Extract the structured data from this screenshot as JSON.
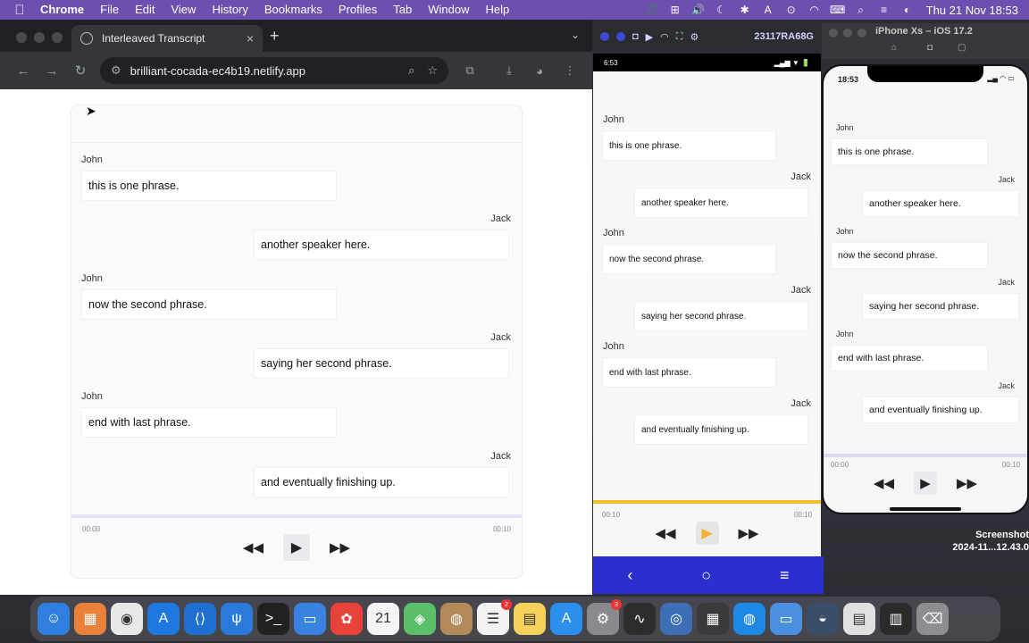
{
  "menubar": {
    "apple": "",
    "app": "Chrome",
    "items": [
      "File",
      "Edit",
      "View",
      "History",
      "Bookmarks",
      "Profiles",
      "Tab",
      "Window",
      "Help"
    ],
    "status_icons": [
      "🎵",
      "⊞",
      "🔊",
      "☾",
      "✱",
      "A",
      "⊙",
      "◠",
      "⌨",
      "⌕",
      "≡",
      "◐"
    ],
    "clock": "Thu 21 Nov  18:53"
  },
  "chrome": {
    "tab_title": "Interleaved Transcript",
    "tab_close": "×",
    "new_tab": "+",
    "tab_menu": "⌄",
    "url": "brilliant-cocada-ec4b19.netlify.app",
    "nav_back": "←",
    "nav_forward": "→",
    "nav_reload": "↻"
  },
  "transcript": {
    "turns": [
      {
        "speaker": "John",
        "text": "this is one phrase."
      },
      {
        "speaker": "Jack",
        "text": "another speaker here."
      },
      {
        "speaker": "John",
        "text": "now the second phrase."
      },
      {
        "speaker": "Jack",
        "text": "saying her second phrase."
      },
      {
        "speaker": "John",
        "text": "end with last phrase."
      },
      {
        "speaker": "Jack",
        "text": "and eventually finishing up."
      }
    ],
    "player": {
      "current_time": "00:00",
      "duration": "00:10",
      "progress": 0,
      "rewind": "◀◀",
      "play": "▶",
      "forward": "▶▶"
    }
  },
  "android": {
    "window_title": "23117RA68G",
    "status_time": "6:53",
    "status_signal": "▂▄▆ ▼ 🔋",
    "current_time": "00:10",
    "duration": "00:10",
    "progress": 1.0,
    "nav_back": "‹",
    "nav_home": "○",
    "nav_menu": "≡"
  },
  "ios": {
    "window_title": "iPhone Xs – iOS 17.2",
    "status_time": "18:53",
    "status_icons": "▂▄ ◠ ▭",
    "current_time": "00:00",
    "duration": "00:10",
    "progress": 0
  },
  "screenshot_label": {
    "line1": "Screenshot",
    "line2": "2024-11...12.43.0"
  },
  "dock": {
    "icons": [
      {
        "name": "finder-icon",
        "color": "#2f7fe0",
        "glyph": "☺"
      },
      {
        "name": "launchpad-icon",
        "color": "#e9813b",
        "glyph": "▦"
      },
      {
        "name": "chrome-icon",
        "color": "#e8e8e8",
        "glyph": "◉"
      },
      {
        "name": "xcode-icon",
        "color": "#1e78e0",
        "glyph": "A"
      },
      {
        "name": "vscode-icon",
        "color": "#1f6fd1",
        "glyph": "⟨⟩"
      },
      {
        "name": "fork-icon",
        "color": "#2a7ad9",
        "glyph": "ψ"
      },
      {
        "name": "terminal-icon",
        "color": "#222222",
        "glyph": ">_"
      },
      {
        "name": "simulator-icon",
        "color": "#3a82e2",
        "glyph": "▭"
      },
      {
        "name": "photo-icon",
        "color": "#e8423a",
        "glyph": "✿"
      },
      {
        "name": "calendar-icon",
        "color": "#f4f4f4",
        "glyph": "21"
      },
      {
        "name": "maps-icon",
        "color": "#5bbf6a",
        "glyph": "◈"
      },
      {
        "name": "contacts-icon",
        "color": "#b58a5a",
        "glyph": "◍"
      },
      {
        "name": "reminders-icon",
        "color": "#f2f2f2",
        "glyph": "☰",
        "badge": "2"
      },
      {
        "name": "notes-icon",
        "color": "#f6d25a",
        "glyph": "▤"
      },
      {
        "name": "app-store-icon",
        "color": "#2c8fee",
        "glyph": "A"
      },
      {
        "name": "system-settings-icon",
        "color": "#8a8a8e",
        "glyph": "⚙",
        "badge": "3"
      },
      {
        "name": "activity-monitor-icon",
        "color": "#2d2d2d",
        "glyph": "∿"
      },
      {
        "name": "network-icon",
        "color": "#3c6fb6",
        "glyph": "◎"
      },
      {
        "name": "calculator-icon",
        "color": "#3a3a3c",
        "glyph": "▦"
      },
      {
        "name": "safari-icon",
        "color": "#1e88e5",
        "glyph": "◍"
      },
      {
        "name": "simulator2-icon",
        "color": "#4a8fe2",
        "glyph": "▭"
      },
      {
        "name": "android-studio-icon",
        "color": "#3c4d6a",
        "glyph": "◒"
      },
      {
        "name": "document-icon",
        "color": "#e0e0e0",
        "glyph": "▤"
      },
      {
        "name": "screenshot-stack-icon",
        "color": "#2b2b2b",
        "glyph": "▥"
      },
      {
        "name": "trash-icon",
        "color": "#8d8d92",
        "glyph": "⌫"
      }
    ]
  }
}
